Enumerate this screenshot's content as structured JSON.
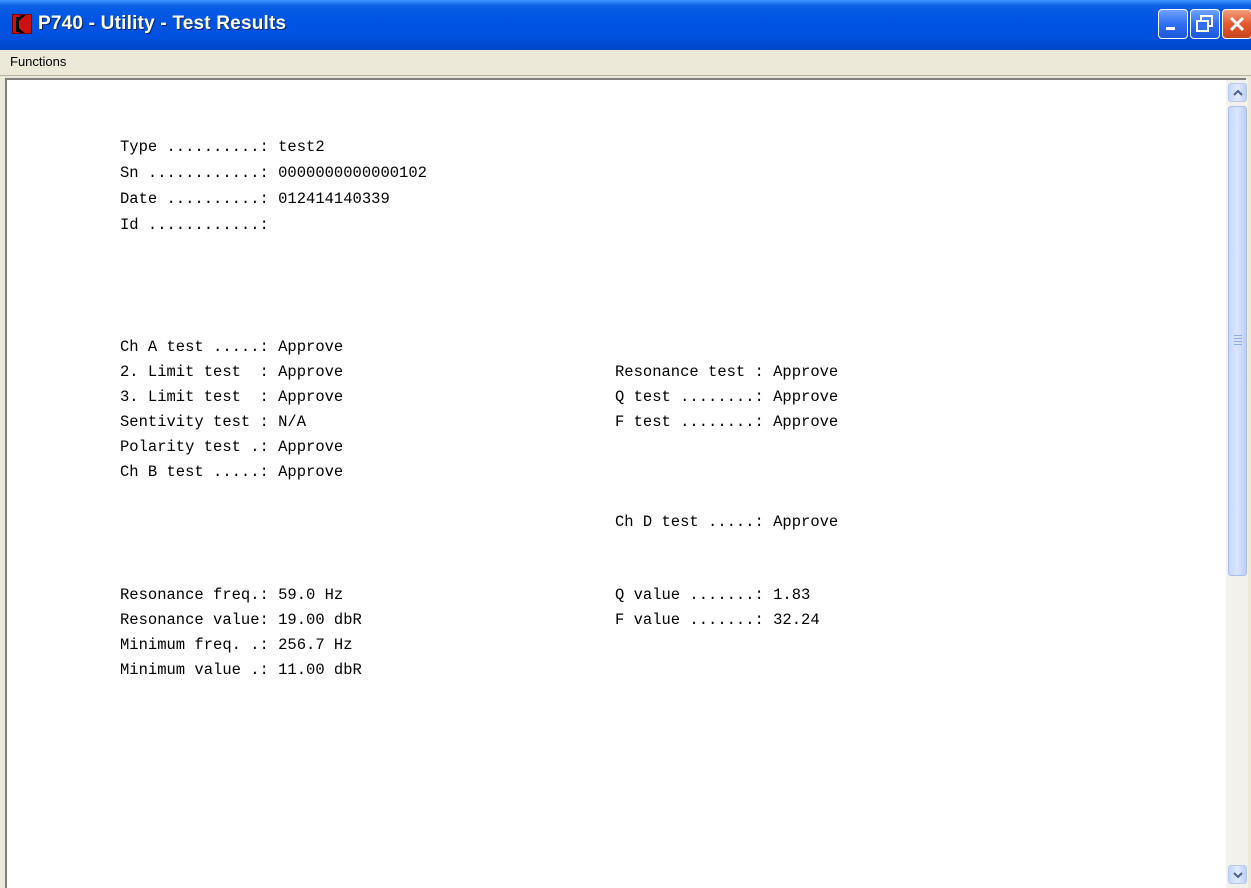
{
  "window": {
    "title": "P740 - Utility - Test Results"
  },
  "menubar": {
    "items": [
      "Functions"
    ]
  },
  "report": {
    "header": [
      "Type ..........: test2",
      "Sn ............: 0000000000000102",
      "Date ..........: 012414140339",
      "Id ............:"
    ],
    "tests_left": [
      "Ch A test .....: Approve",
      "2. Limit test  : Approve",
      "3. Limit test  : Approve",
      "Sentivity test : N/A",
      "Polarity test .: Approve",
      "Ch B test .....: Approve"
    ],
    "tests_right": [
      "Resonance test : Approve",
      "Q test ........: Approve",
      "F test ........: Approve"
    ],
    "ch_d": "Ch D test .....: Approve",
    "values_left": [
      "Resonance freq.: 59.0 Hz",
      "Resonance value: 19.00 dbR",
      "Minimum freq. .: 256.7 Hz",
      "Minimum value .: 11.00 dbR"
    ],
    "values_right": [
      "Q value .......: 1.83",
      "F value .......: 32.24"
    ]
  }
}
